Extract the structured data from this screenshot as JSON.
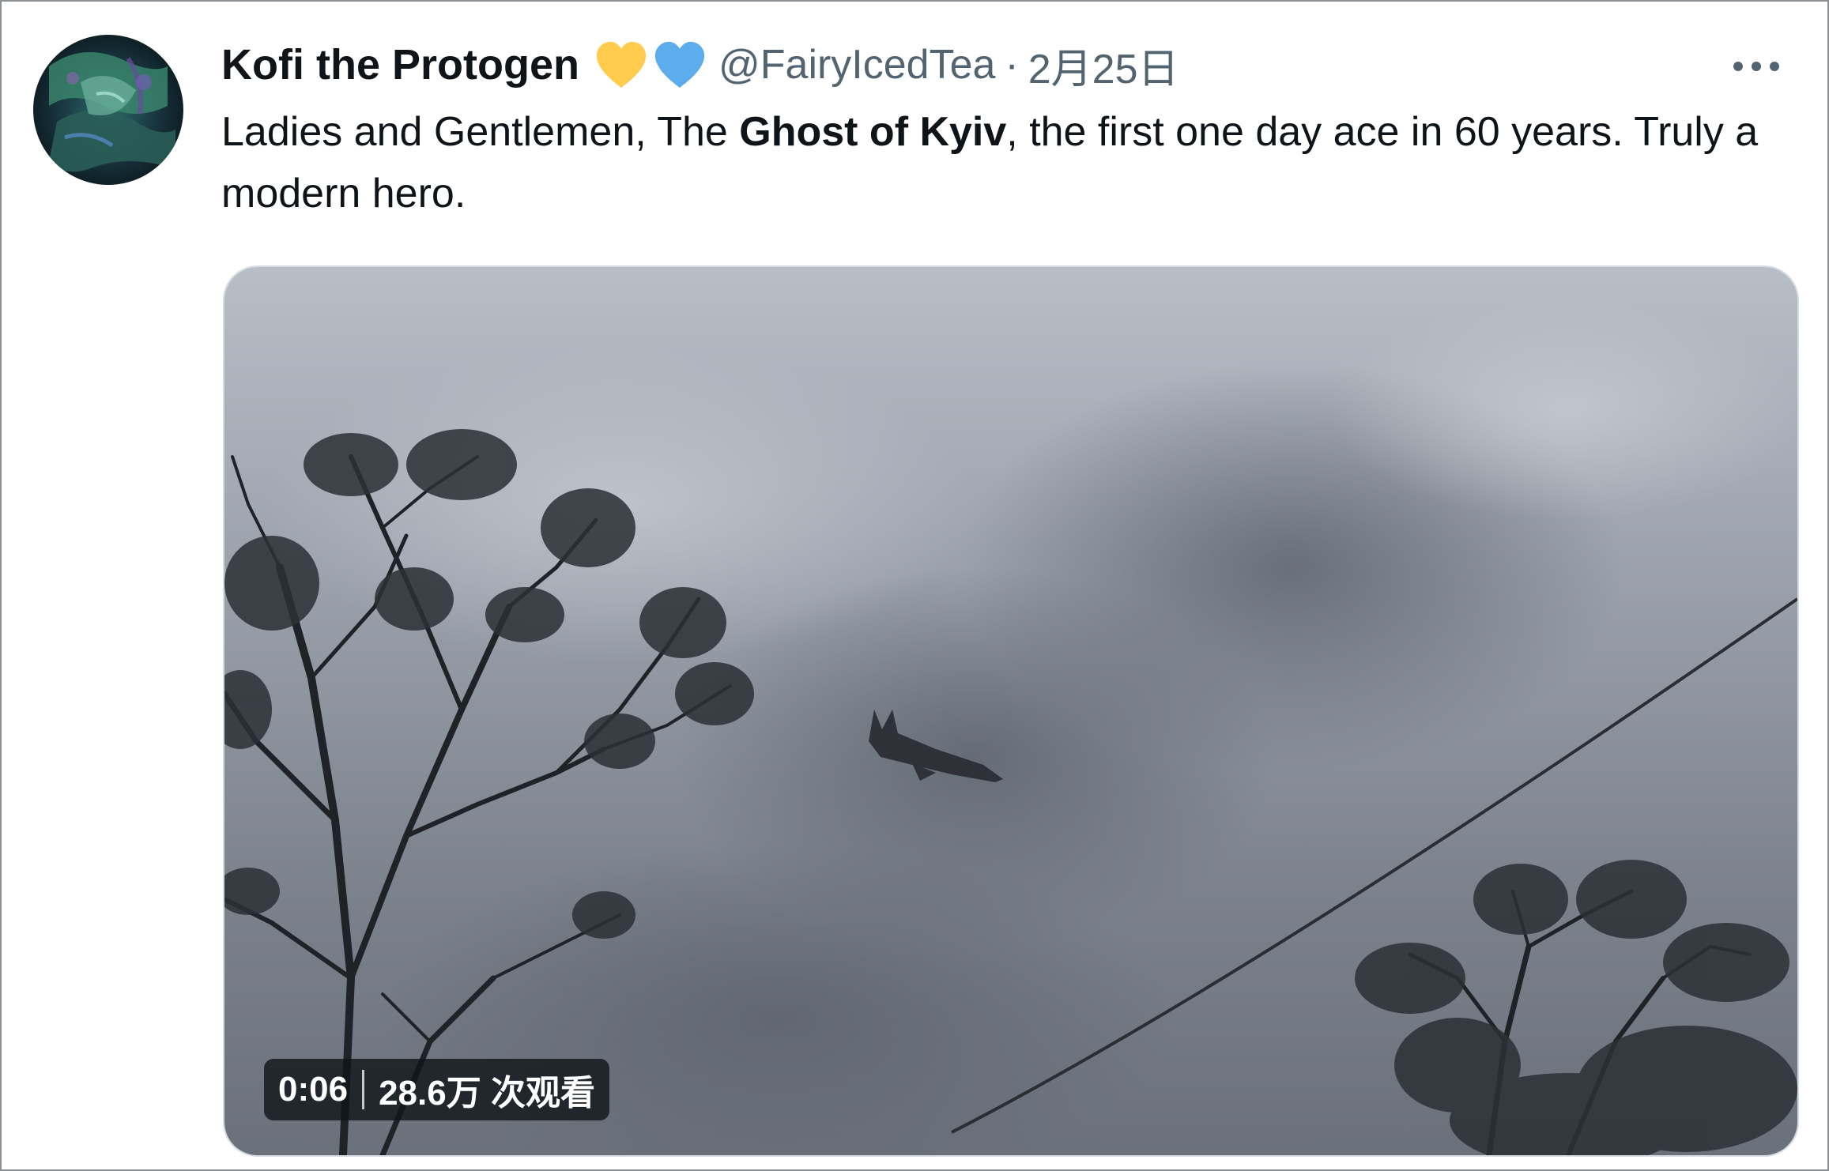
{
  "tweet": {
    "display_name": "Kofi the Protogen",
    "handle": "@FairyIcedTea",
    "separator": "·",
    "date": "2月25日",
    "emoji": [
      {
        "name": "yellow-heart",
        "color": "#ffcc4d"
      },
      {
        "name": "blue-heart",
        "color": "#5dadec"
      }
    ],
    "more_icon": "more-horizontal-icon",
    "text": {
      "part1": "Ladies and Gentlemen, The ",
      "bold": "Ghost of Kyiv",
      "part2": ", the first one day ace in 60 years. Truly a modern hero."
    },
    "media": {
      "type": "video",
      "duration": "0:06",
      "views": "28.6万 次观看"
    }
  },
  "colors": {
    "text_primary": "#0f1419",
    "text_secondary": "#536471",
    "border": "#8a8f94"
  }
}
